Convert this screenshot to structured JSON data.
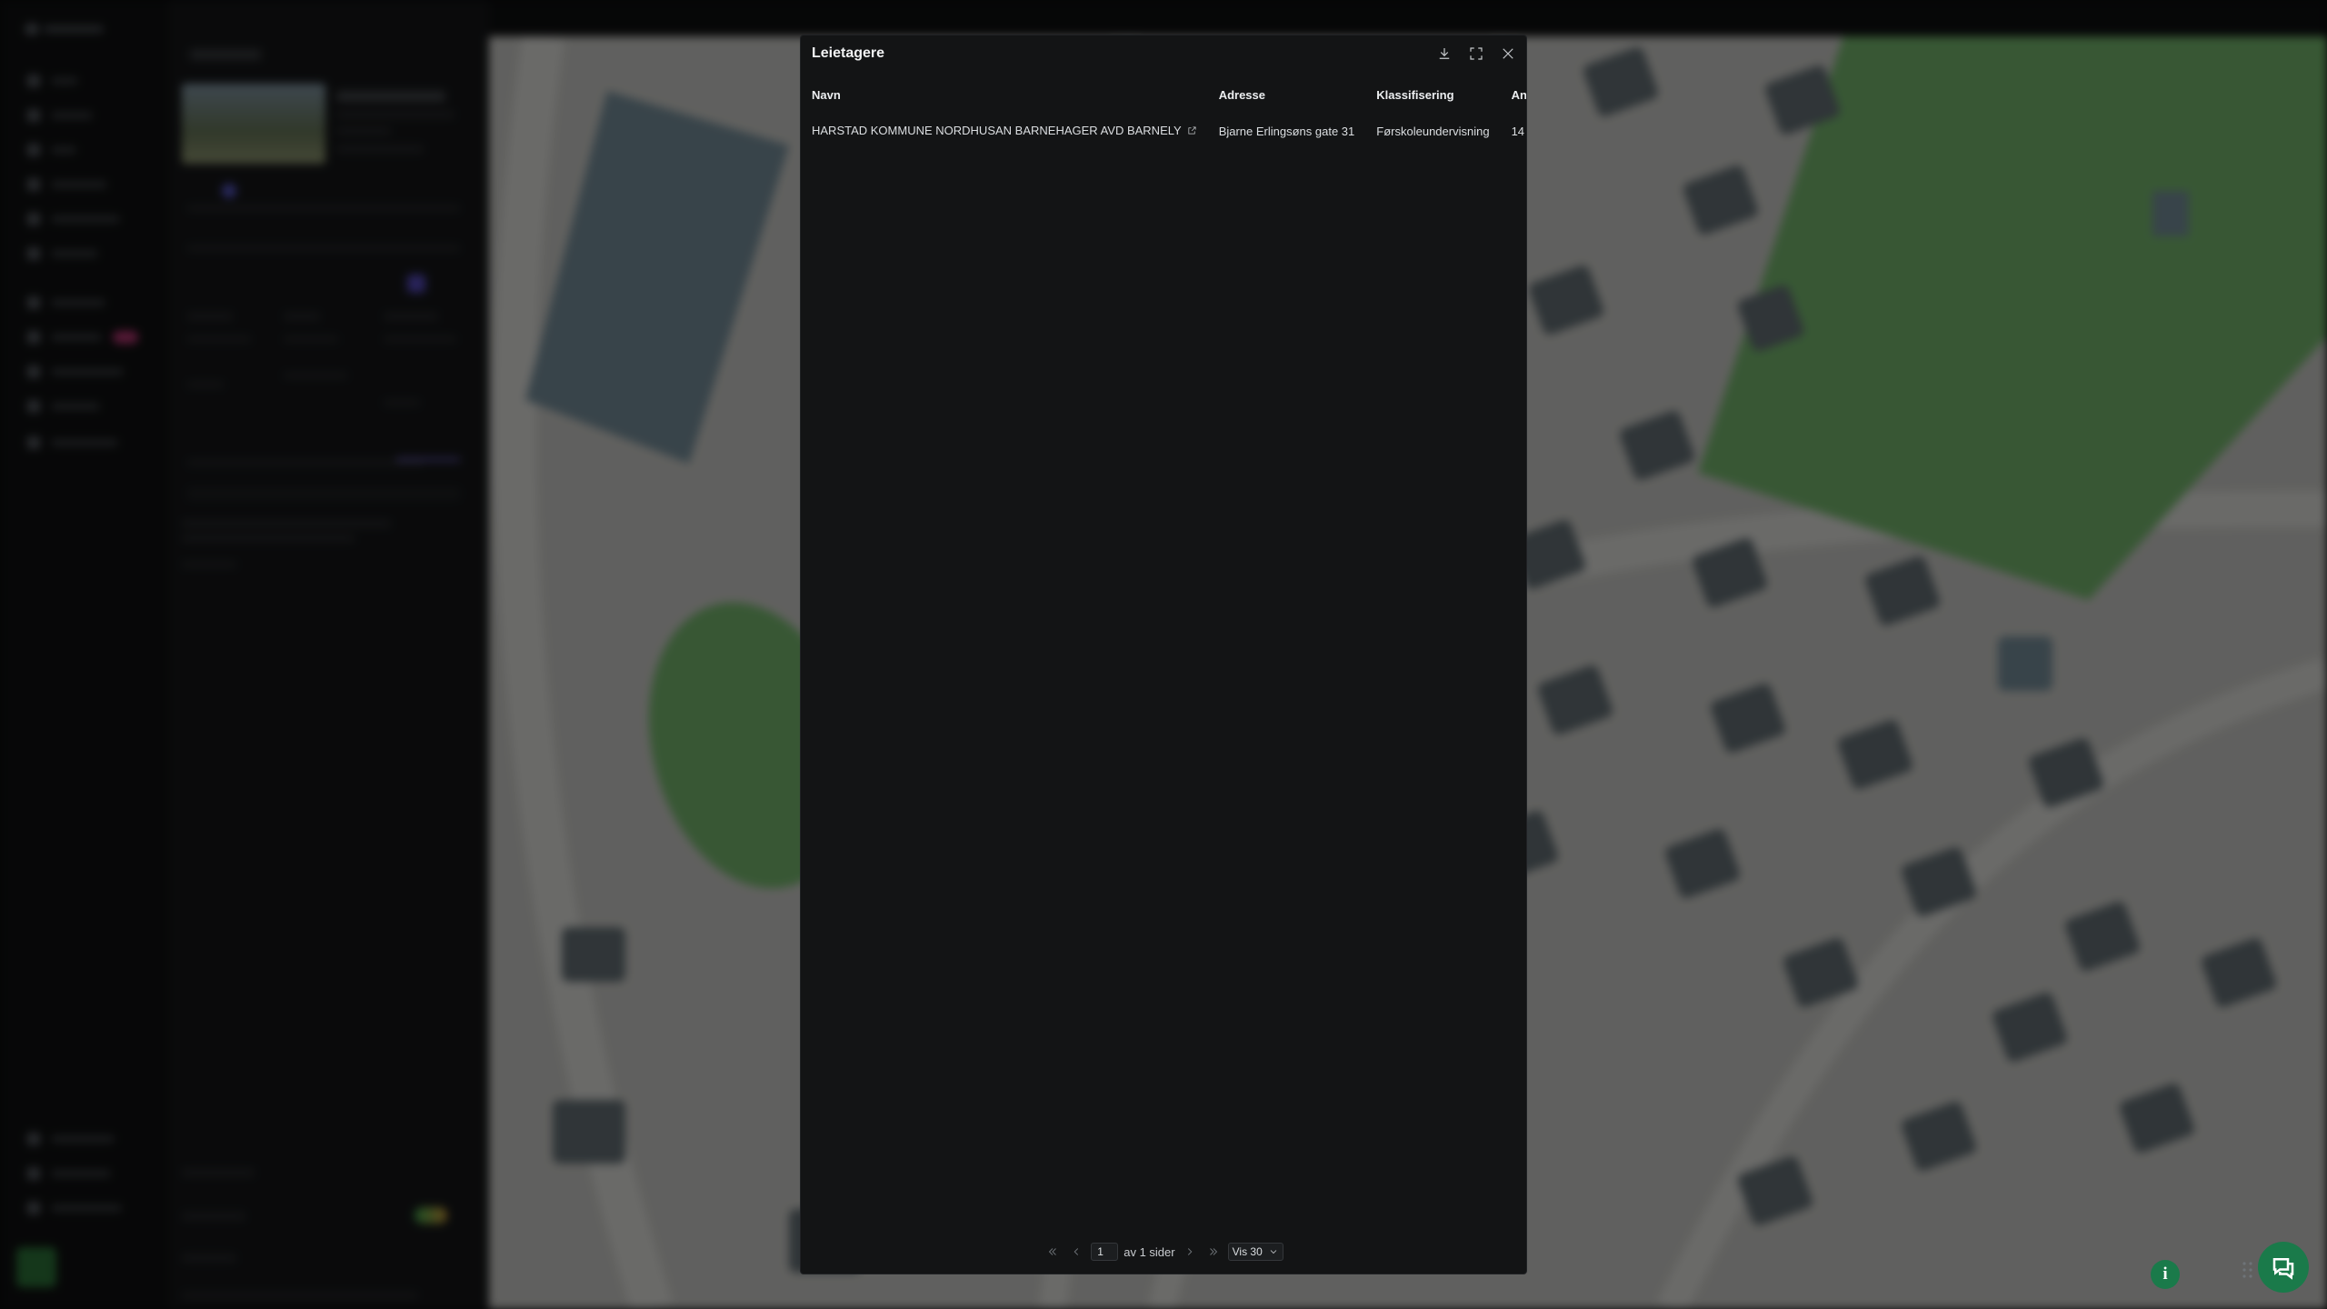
{
  "modal": {
    "title": "Leietagere",
    "columns": [
      "Navn",
      "Adresse",
      "Klassifisering",
      "Ans"
    ],
    "rows": [
      {
        "navn": "HARSTAD KOMMUNE NORDHUSAN BARNEHAGER AVD BARNELY",
        "adresse": "Bjarne Erlingsøns gate 31",
        "klassifisering": "Førskoleundervisning",
        "ansatte": "14"
      }
    ],
    "pager": {
      "current_page": "1",
      "of_pages": "av 1 sider",
      "page_size": "Vis 30"
    },
    "icons": {
      "download": "download-icon",
      "fullscreen": "fullscreen-icon",
      "close": "close-icon",
      "external_link": "external-link-icon",
      "first_page": "double-chevron-left-icon",
      "prev_page": "chevron-left-icon",
      "next_page": "chevron-right-icon",
      "last_page": "double-chevron-right-icon",
      "page_size_toggle": "chevron-down-icon"
    }
  },
  "colors": {
    "modal_bg": "#131415",
    "accent_green": "#1a7a4a",
    "map_green": "#6fb86a",
    "map_building": "#5e6a70"
  },
  "floating": {
    "info_label": "i",
    "info_icon": "info-icon",
    "chat_icon": "chat-icon"
  }
}
